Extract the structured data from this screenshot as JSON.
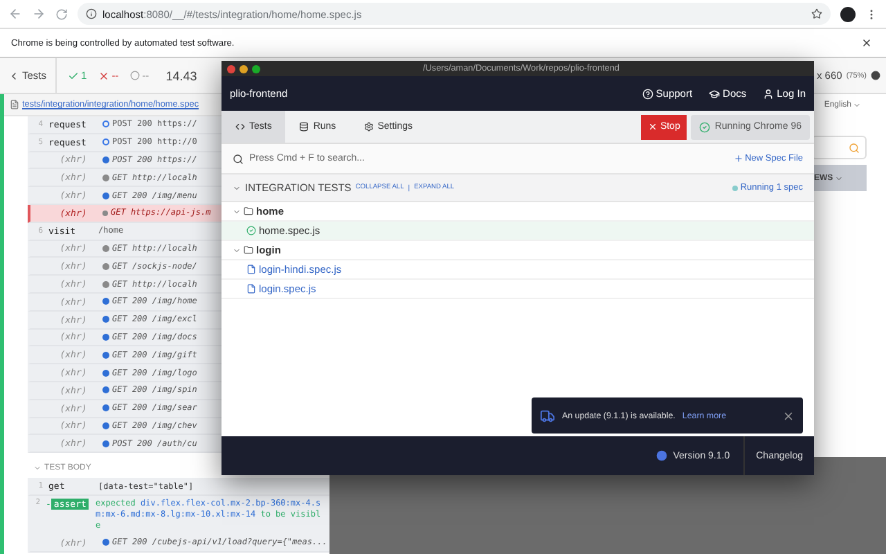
{
  "browser": {
    "url_host": "localhost",
    "url_path": ":8080/__/#/tests/integration/home/home.spec.js"
  },
  "automation_banner": {
    "message": "Chrome is being controlled by automated test software."
  },
  "runner": {
    "back": "Tests",
    "passed": "1",
    "failed": "--",
    "pending": "--",
    "duration": "14.43",
    "viewport": "x 660",
    "scale": "(75%)"
  },
  "spec_path": "tests/integration/integration/home/home.spec",
  "command_log": [
    {
      "number": "4",
      "command": "request",
      "kind": "ring",
      "color": "#3b78e7",
      "message": "POST 200 https://",
      "failed": false
    },
    {
      "number": "5",
      "command": "request",
      "kind": "ring",
      "color": "#3b78e7",
      "message": "POST 200 http://0",
      "failed": false
    },
    {
      "command": "(xhr)",
      "kind": "dot",
      "color": "#2f6fd6",
      "message": "POST 200 https://",
      "failed": false
    },
    {
      "command": "(xhr)",
      "kind": "dot",
      "color": "#8a8a8a",
      "message": "GET http://localh",
      "failed": false
    },
    {
      "command": "(xhr)",
      "kind": "dot",
      "color": "#2f6fd6",
      "message": "GET 200 /img/menu",
      "failed": false
    },
    {
      "command": "(xhr)",
      "kind": "dot",
      "color": "#8a8a8a",
      "message": "GET https://api-js.m",
      "failed": true
    },
    {
      "number": "6",
      "command": "visit",
      "kind": "plain",
      "message": "/home",
      "failed": false
    },
    {
      "command": "(xhr)",
      "kind": "dot",
      "color": "#8a8a8a",
      "message": "GET http://localh",
      "failed": false
    },
    {
      "command": "(xhr)",
      "kind": "dot",
      "color": "#8a8a8a",
      "message": "GET /sockjs-node/",
      "failed": false
    },
    {
      "command": "(xhr)",
      "kind": "dot",
      "color": "#8a8a8a",
      "message": "GET http://localh",
      "failed": false
    },
    {
      "command": "(xhr)",
      "kind": "dot",
      "color": "#2f6fd6",
      "message": "GET 200 /img/home",
      "failed": false
    },
    {
      "command": "(xhr)",
      "kind": "dot",
      "color": "#2f6fd6",
      "message": "GET 200 /img/excl",
      "failed": false
    },
    {
      "command": "(xhr)",
      "kind": "dot",
      "color": "#2f6fd6",
      "message": "GET 200 /img/docs",
      "failed": false
    },
    {
      "command": "(xhr)",
      "kind": "dot",
      "color": "#2f6fd6",
      "message": "GET 200 /img/gift",
      "failed": false
    },
    {
      "command": "(xhr)",
      "kind": "dot",
      "color": "#2f6fd6",
      "message": "GET 200 /img/logo",
      "failed": false
    },
    {
      "command": "(xhr)",
      "kind": "dot",
      "color": "#2f6fd6",
      "message": "GET 200 /img/spin",
      "failed": false
    },
    {
      "command": "(xhr)",
      "kind": "dot",
      "color": "#2f6fd6",
      "message": "GET 200 /img/sear",
      "failed": false
    },
    {
      "command": "(xhr)",
      "kind": "dot",
      "color": "#2f6fd6",
      "message": "GET 200 /img/chev",
      "failed": false
    },
    {
      "command": "(xhr)",
      "kind": "dot",
      "color": "#2f6fd6",
      "message": "POST 200 /auth/cu",
      "failed": false
    }
  ],
  "test_body": {
    "title": "TEST BODY",
    "rows": [
      {
        "kind": "command",
        "number": "1",
        "command": "get",
        "message": "[data-test=\"table\"]"
      },
      {
        "kind": "assert",
        "number": "2",
        "prefix": "-",
        "command": "assert",
        "expected": "expected",
        "subject": "div.flex.flex-col.mx-2.bp-360:mx-4.sm:mx-6.md:mx-8.lg:mx-10.xl:mx-14",
        "predicate": "to be visible"
      },
      {
        "kind": "xhr",
        "command": "(xhr)",
        "color": "#2f6fd6",
        "message": "GET 200 /cubejs-api/v1/load?query={\"meas..."
      }
    ]
  },
  "app_preview": {
    "language": "English",
    "table_header": "EWS"
  },
  "window": {
    "title": "/Users/aman/Documents/Work/repos/plio-frontend",
    "project": "plio-frontend",
    "header_links": [
      {
        "label": "Support",
        "kind": "help"
      },
      {
        "label": "Docs",
        "kind": "docs"
      },
      {
        "label": "Log In",
        "kind": "user"
      }
    ],
    "tabs": [
      {
        "label": "Tests",
        "kind": "code",
        "selected": true
      },
      {
        "label": "Runs",
        "kind": "runs",
        "selected": false
      },
      {
        "label": "Settings",
        "kind": "settings",
        "selected": false
      }
    ],
    "stop_button": "Stop",
    "browser_status": "Running Chrome 96",
    "search": {
      "placeholder": "Press Cmd + F to search..."
    },
    "new_spec": "New Spec File",
    "section": {
      "title": "INTEGRATION TESTS",
      "collapse_all": "COLLAPSE ALL",
      "separator": "|",
      "expand_all": "EXPAND ALL",
      "running": "Running 1 spec",
      "expanded": true
    },
    "tree": [
      {
        "label": "home",
        "kind": "folder",
        "expanded": true,
        "children": [
          {
            "label": "home.spec.js",
            "kind": "spec",
            "selected": true
          }
        ]
      },
      {
        "label": "login",
        "kind": "folder",
        "expanded": true,
        "children": [
          {
            "label": "login-hindi.spec.js",
            "kind": "spec",
            "selected": false
          },
          {
            "label": "login.spec.js",
            "kind": "spec",
            "selected": false
          }
        ]
      }
    ],
    "notification": {
      "message": "An update (9.1.1) is available.",
      "link": "Learn more"
    },
    "footer": {
      "version": "Version 9.1.0",
      "changelog": "Changelog"
    }
  }
}
